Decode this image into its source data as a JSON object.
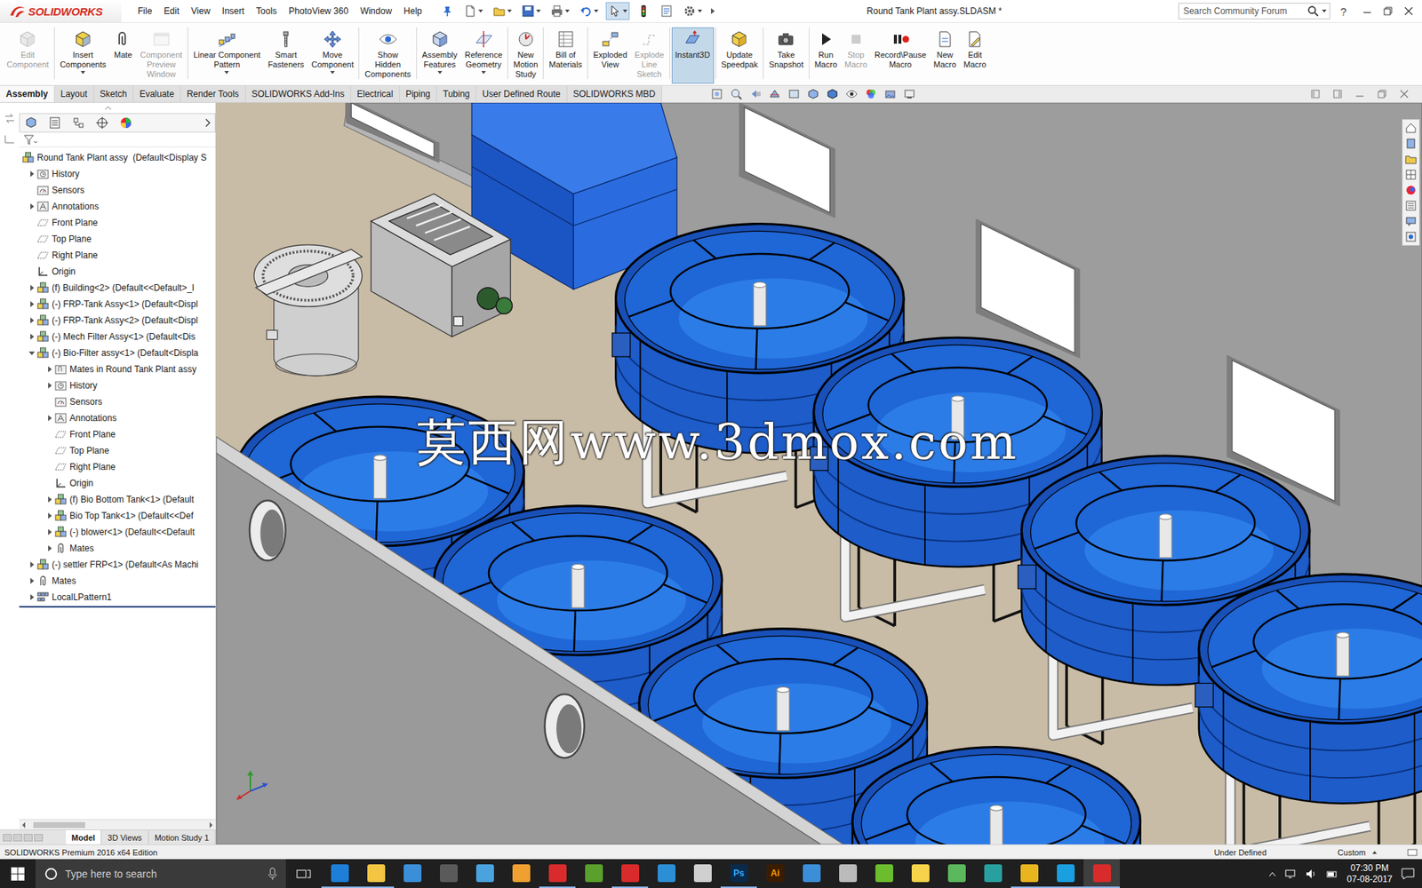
{
  "window": {
    "title": "Round Tank Plant assy.SLDASM *",
    "brand": "SOLIDWORKS",
    "help": "?"
  },
  "menu": [
    "File",
    "Edit",
    "View",
    "Insert",
    "Tools",
    "PhotoView 360",
    "Window",
    "Help"
  ],
  "search": {
    "placeholder": "Search Community Forum"
  },
  "toolbar": {
    "buttons": [
      {
        "lines": [
          "Edit",
          "Component"
        ],
        "disabled": true,
        "selected": false,
        "dropdown": false
      },
      {
        "lines": [
          "Insert",
          "Components"
        ],
        "disabled": false,
        "selected": false,
        "dropdown": true
      },
      {
        "lines": [
          "Mate"
        ],
        "disabled": false,
        "selected": false,
        "dropdown": false
      },
      {
        "lines": [
          "Component",
          "Preview",
          "Window"
        ],
        "disabled": true,
        "selected": false,
        "dropdown": false
      },
      {
        "lines": [
          "Linear Component",
          "Pattern"
        ],
        "disabled": false,
        "selected": false,
        "dropdown": true
      },
      {
        "lines": [
          "Smart",
          "Fasteners"
        ],
        "disabled": false,
        "selected": false,
        "dropdown": false
      },
      {
        "lines": [
          "Move",
          "Component"
        ],
        "disabled": false,
        "selected": false,
        "dropdown": true
      },
      {
        "lines": [
          "Show",
          "Hidden",
          "Components"
        ],
        "disabled": false,
        "selected": false,
        "dropdown": false
      },
      {
        "lines": [
          "Assembly",
          "Features"
        ],
        "disabled": false,
        "selected": false,
        "dropdown": true
      },
      {
        "lines": [
          "Reference",
          "Geometry"
        ],
        "disabled": false,
        "selected": false,
        "dropdown": true
      },
      {
        "lines": [
          "New",
          "Motion",
          "Study"
        ],
        "disabled": false,
        "selected": false,
        "dropdown": false
      },
      {
        "lines": [
          "Bill of",
          "Materials"
        ],
        "disabled": false,
        "selected": false,
        "dropdown": false
      },
      {
        "lines": [
          "Exploded",
          "View"
        ],
        "disabled": false,
        "selected": false,
        "dropdown": false
      },
      {
        "lines": [
          "Explode",
          "Line",
          "Sketch"
        ],
        "disabled": true,
        "selected": false,
        "dropdown": false
      },
      {
        "lines": [
          "Instant3D"
        ],
        "disabled": false,
        "selected": true,
        "dropdown": false
      },
      {
        "lines": [
          "Update",
          "Speedpak"
        ],
        "disabled": false,
        "selected": false,
        "dropdown": false
      },
      {
        "lines": [
          "Take",
          "Snapshot"
        ],
        "disabled": false,
        "selected": false,
        "dropdown": false
      },
      {
        "lines": [
          "Run",
          "Macro"
        ],
        "disabled": false,
        "selected": false,
        "dropdown": false
      },
      {
        "lines": [
          "Stop",
          "Macro"
        ],
        "disabled": true,
        "selected": false,
        "dropdown": false
      },
      {
        "lines": [
          "Record\\Pause",
          "Macro"
        ],
        "disabled": false,
        "selected": false,
        "dropdown": false
      },
      {
        "lines": [
          "New",
          "Macro"
        ],
        "disabled": false,
        "selected": false,
        "dropdown": false
      },
      {
        "lines": [
          "Edit",
          "Macro"
        ],
        "disabled": false,
        "selected": false,
        "dropdown": false
      }
    ]
  },
  "tabs": [
    {
      "label": "Assembly",
      "selected": true
    },
    {
      "label": "Layout",
      "selected": false
    },
    {
      "label": "Sketch",
      "selected": false
    },
    {
      "label": "Evaluate",
      "selected": false
    },
    {
      "label": "Render Tools",
      "selected": false
    },
    {
      "label": "SOLIDWORKS Add-Ins",
      "selected": false
    },
    {
      "label": "Electrical",
      "selected": false
    },
    {
      "label": "Piping",
      "selected": false
    },
    {
      "label": "Tubing",
      "selected": false
    },
    {
      "label": "User Defined Route",
      "selected": false
    },
    {
      "label": "SOLIDWORKS MBD",
      "selected": false
    }
  ],
  "tree": {
    "items": [
      {
        "label": "Round Tank Plant assy  (Default<Display S",
        "level": 0,
        "expandable": false,
        "expanded": false,
        "icon": "assembly"
      },
      {
        "label": "History",
        "level": 1,
        "expandable": true,
        "expanded": false,
        "icon": "history"
      },
      {
        "label": "Sensors",
        "level": 1,
        "expandable": false,
        "expanded": false,
        "icon": "sensor"
      },
      {
        "label": "Annotations",
        "level": 1,
        "expandable": true,
        "expanded": false,
        "icon": "annotation"
      },
      {
        "label": "Front Plane",
        "level": 1,
        "expandable": false,
        "expanded": false,
        "icon": "plane"
      },
      {
        "label": "Top Plane",
        "level": 1,
        "expandable": false,
        "expanded": false,
        "icon": "plane"
      },
      {
        "label": "Right Plane",
        "level": 1,
        "expandable": false,
        "expanded": false,
        "icon": "plane"
      },
      {
        "label": "Origin",
        "level": 1,
        "expandable": false,
        "expanded": false,
        "icon": "origin"
      },
      {
        "label": "(f) Building<2> (Default<<Default>_I",
        "level": 1,
        "expandable": true,
        "expanded": false,
        "icon": "assembly"
      },
      {
        "label": "(-) FRP-Tank Assy<1> (Default<Displ",
        "level": 1,
        "expandable": true,
        "expanded": false,
        "icon": "assembly"
      },
      {
        "label": "(-) FRP-Tank Assy<2> (Default<Displ",
        "level": 1,
        "expandable": true,
        "expanded": false,
        "icon": "assembly"
      },
      {
        "label": "(-) Mech Filter Assy<1> (Default<Dis",
        "level": 1,
        "expandable": true,
        "expanded": false,
        "icon": "assembly"
      },
      {
        "label": "(-) Bio-Filter assy<1> (Default<Displa",
        "level": 1,
        "expandable": true,
        "expanded": true,
        "icon": "assembly"
      },
      {
        "label": "Mates in Round Tank Plant assy",
        "level": 2,
        "expandable": true,
        "expanded": false,
        "icon": "folder"
      },
      {
        "label": "History",
        "level": 2,
        "expandable": true,
        "expanded": false,
        "icon": "history"
      },
      {
        "label": "Sensors",
        "level": 2,
        "expandable": false,
        "expanded": false,
        "icon": "sensor"
      },
      {
        "label": "Annotations",
        "level": 2,
        "expandable": true,
        "expanded": false,
        "icon": "annotation"
      },
      {
        "label": "Front Plane",
        "level": 2,
        "expandable": false,
        "expanded": false,
        "icon": "plane"
      },
      {
        "label": "Top Plane",
        "level": 2,
        "expandable": false,
        "expanded": false,
        "icon": "plane"
      },
      {
        "label": "Right Plane",
        "level": 2,
        "expandable": false,
        "expanded": false,
        "icon": "plane"
      },
      {
        "label": "Origin",
        "level": 2,
        "expandable": false,
        "expanded": false,
        "icon": "origin"
      },
      {
        "label": "(f) Bio Bottom Tank<1> (Default",
        "level": 2,
        "expandable": true,
        "expanded": false,
        "icon": "assembly"
      },
      {
        "label": "Bio Top Tank<1> (Default<<Def",
        "level": 2,
        "expandable": true,
        "expanded": false,
        "icon": "assembly"
      },
      {
        "label": "(-) blower<1> (Default<<Default",
        "level": 2,
        "expandable": true,
        "expanded": false,
        "icon": "assembly"
      },
      {
        "label": "Mates",
        "level": 2,
        "expandable": true,
        "expanded": false,
        "icon": "mates"
      },
      {
        "label": "(-) settler FRP<1> (Default<As Machi",
        "level": 1,
        "expandable": true,
        "expanded": false,
        "icon": "assembly"
      },
      {
        "label": "Mates",
        "level": 1,
        "expandable": true,
        "expanded": false,
        "icon": "mates"
      },
      {
        "label": "LocalLPattern1",
        "level": 1,
        "expandable": true,
        "expanded": false,
        "icon": "pattern"
      }
    ]
  },
  "panel_tabs": [
    {
      "label": "Model",
      "selected": true
    },
    {
      "label": "3D Views",
      "selected": false
    },
    {
      "label": "Motion Study 1",
      "selected": false
    }
  ],
  "viewport": {
    "watermark": "莫西网www.3dmox.com"
  },
  "status_bar": {
    "edition": "SOLIDWORKS Premium 2016 x64 Edition",
    "state": "Under Defined",
    "units": "Custom"
  },
  "taskbar": {
    "search_placeholder": "Type here to search",
    "apps": [
      {
        "color": "#1e7fd8",
        "running": true,
        "active": false
      },
      {
        "color": "#f4c542",
        "running": true,
        "active": false
      },
      {
        "color": "#3b8fd9",
        "running": false,
        "active": false
      },
      {
        "color": "#5a5a5a",
        "running": false,
        "active": false
      },
      {
        "color": "#4aa3df",
        "running": false,
        "active": false
      },
      {
        "color": "#f0a030",
        "running": false,
        "active": false
      },
      {
        "color": "#d92b2b",
        "running": true,
        "active": false
      },
      {
        "color": "#5aa02c",
        "running": false,
        "active": false
      },
      {
        "color": "#d92b2b",
        "running": true,
        "active": false
      },
      {
        "color": "#2c8fd6",
        "running": false,
        "active": false
      },
      {
        "color": "#d0d0d0",
        "running": false,
        "active": false
      },
      {
        "label": "Ps",
        "color": "#0b2a4a",
        "running": true,
        "active": false
      },
      {
        "label": "Ai",
        "color": "#3a1c00",
        "running": false,
        "active": false
      },
      {
        "color": "#3b8fd9",
        "running": false,
        "active": false
      },
      {
        "color": "#bbbbbb",
        "running": false,
        "active": false
      },
      {
        "color": "#6cbd2e",
        "running": false,
        "active": false
      },
      {
        "color": "#f6d34a",
        "running": false,
        "active": false
      },
      {
        "color": "#5cb85c",
        "running": false,
        "active": false
      },
      {
        "color": "#29a0a0",
        "running": false,
        "active": false
      },
      {
        "color": "#e9b51e",
        "running": true,
        "active": false
      },
      {
        "color": "#1a9fe0",
        "running": true,
        "active": false
      },
      {
        "color": "#d92b2b",
        "running": true,
        "active": true
      }
    ],
    "time": "07:30 PM",
    "date": "07-08-2017"
  }
}
